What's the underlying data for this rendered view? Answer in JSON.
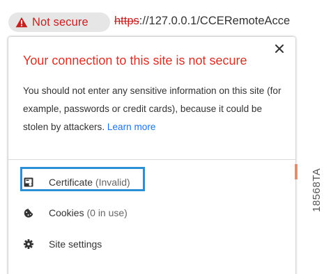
{
  "address_bar": {
    "security_label": "Not secure",
    "url_scheme": "https",
    "url_rest": "://127.0.0.1/CCERemoteAcce"
  },
  "popup": {
    "title": "Your connection to this site is not secure",
    "description": "You should not enter any sensitive information on this site (for example, passwords or credit cards), because it could be stolen by attackers.",
    "learn_more": "Learn more",
    "items": [
      {
        "label": "Certificate",
        "detail": "(Invalid)"
      },
      {
        "label": "Cookies",
        "detail": "(0 in use)"
      },
      {
        "label": "Site settings",
        "detail": ""
      }
    ]
  },
  "figure_code": "18568TA",
  "colors": {
    "warning_red": "#d93025",
    "link_blue": "#1a73e8",
    "highlight_blue": "#2a8fd4"
  },
  "icons": [
    "warning-triangle-icon",
    "close-icon",
    "certificate-icon",
    "cookie-icon",
    "gear-icon"
  ]
}
